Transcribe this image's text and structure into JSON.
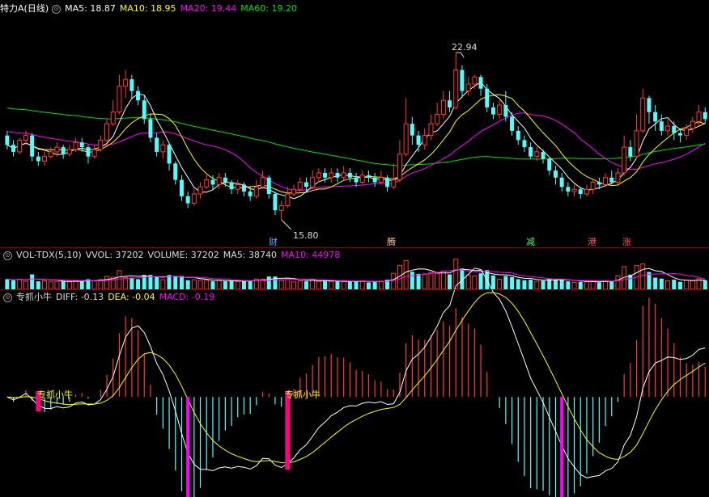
{
  "colors": {
    "bg": "#000000",
    "up": "#ff3b30",
    "down": "#54fcfc",
    "ma5": "#ffffff",
    "ma10": "#ffff00",
    "ma20": "#ff00ff",
    "ma60": "#00e000",
    "signal": "#ff0080",
    "macd_up": "#ff3b30",
    "macd_down": "#54fcfc",
    "macd_mark": "#ff00ff",
    "tag_text": "#ffff00"
  },
  "price_panel": {
    "title": "特力A",
    "period": "(日线)",
    "ma5": "MA5: 18.87",
    "ma10": "MA10: 18.95",
    "ma20": "MA20: 19.44",
    "ma60": "MA60: 19.20",
    "high_label": "22.94",
    "low_label": "15.80",
    "events": [
      {
        "label": "财",
        "color": "#6aa9ff"
      },
      {
        "label": "腾",
        "color": "#ffcc88"
      },
      {
        "label": "减",
        "color": "#55ff55"
      },
      {
        "label": "港",
        "color": "#ff5555"
      },
      {
        "label": "涨",
        "color": "#ff5555"
      }
    ]
  },
  "vol_panel": {
    "title": "VOL-TDX(5,10)",
    "vvol": "VVOL: 37202",
    "volume": "VOLUME: 37202",
    "ma5": "MA5: 38740",
    "ma10": "MA10: 44978"
  },
  "macd_panel": {
    "title": "专抓小牛",
    "diff": "DIFF: -0.13",
    "dea": "DEA: -0.04",
    "macd": "MACD: -0.19",
    "signal_tags": [
      "专抓小牛",
      "专抓小牛"
    ]
  },
  "chart_data": {
    "type": "candlestick",
    "note_scale": "price",
    "ylim": [
      15.0,
      24.5
    ],
    "candles": [
      [
        19.4,
        19.0,
        19.6,
        18.8
      ],
      [
        19.0,
        18.7,
        19.2,
        18.5
      ],
      [
        18.7,
        19.2,
        19.3,
        18.6
      ],
      [
        19.2,
        19.4,
        19.6,
        19.0
      ],
      [
        19.4,
        18.5,
        19.5,
        18.3
      ],
      [
        18.5,
        18.3,
        18.7,
        18.1
      ],
      [
        18.3,
        18.5,
        18.8,
        18.1
      ],
      [
        18.5,
        18.7,
        18.9,
        18.4
      ],
      [
        18.7,
        18.9,
        19.1,
        18.5
      ],
      [
        18.9,
        18.6,
        19.0,
        18.4
      ],
      [
        18.6,
        18.8,
        19.0,
        18.5
      ],
      [
        18.8,
        19.1,
        19.3,
        18.7
      ],
      [
        19.1,
        18.9,
        19.3,
        18.7
      ],
      [
        18.9,
        18.5,
        19.0,
        18.2
      ],
      [
        18.5,
        18.8,
        19.0,
        18.4
      ],
      [
        18.8,
        19.2,
        19.4,
        18.7
      ],
      [
        19.2,
        19.9,
        20.1,
        19.1
      ],
      [
        19.9,
        20.4,
        20.9,
        19.8
      ],
      [
        20.4,
        21.5,
        22.0,
        20.3
      ],
      [
        21.5,
        21.8,
        22.2,
        21.0
      ],
      [
        21.8,
        21.3,
        22.0,
        21.0
      ],
      [
        21.3,
        20.9,
        21.5,
        20.7
      ],
      [
        20.9,
        20.1,
        21.1,
        19.9
      ],
      [
        20.1,
        19.3,
        20.3,
        19.1
      ],
      [
        19.3,
        18.7,
        19.5,
        18.5
      ],
      [
        18.7,
        19.0,
        19.2,
        18.4
      ],
      [
        19.0,
        18.2,
        19.1,
        17.9
      ],
      [
        18.2,
        17.5,
        18.3,
        17.3
      ],
      [
        17.5,
        16.8,
        17.7,
        16.6
      ],
      [
        16.8,
        16.5,
        17.0,
        16.3
      ],
      [
        16.5,
        16.9,
        17.1,
        16.4
      ],
      [
        16.9,
        17.2,
        17.4,
        16.7
      ],
      [
        17.2,
        17.5,
        17.8,
        17.1
      ],
      [
        17.5,
        17.3,
        17.7,
        17.1
      ],
      [
        17.3,
        17.6,
        17.8,
        17.1
      ],
      [
        17.6,
        17.4,
        17.8,
        17.2
      ],
      [
        17.4,
        17.1,
        17.5,
        16.9
      ],
      [
        17.1,
        17.3,
        17.5,
        16.9
      ],
      [
        17.3,
        17.0,
        17.4,
        16.8
      ],
      [
        17.0,
        16.8,
        17.2,
        16.6
      ],
      [
        16.8,
        17.2,
        17.5,
        16.7
      ],
      [
        17.2,
        17.6,
        17.9,
        17.1
      ],
      [
        17.6,
        16.9,
        17.7,
        16.7
      ],
      [
        16.9,
        16.2,
        17.0,
        16.0
      ],
      [
        16.2,
        16.4,
        16.6,
        15.8
      ],
      [
        16.4,
        16.9,
        17.2,
        16.3
      ],
      [
        16.9,
        17.1,
        17.3,
        16.8
      ],
      [
        17.1,
        17.4,
        17.6,
        17.0
      ],
      [
        17.4,
        17.2,
        17.6,
        17.0
      ],
      [
        17.2,
        17.6,
        17.9,
        17.1
      ],
      [
        17.6,
        17.8,
        18.0,
        17.4
      ],
      [
        17.8,
        17.6,
        18.0,
        17.4
      ],
      [
        17.6,
        17.8,
        18.0,
        17.4
      ],
      [
        17.8,
        17.6,
        18.0,
        17.4
      ],
      [
        17.6,
        17.8,
        18.1,
        17.5
      ],
      [
        17.8,
        17.6,
        18.0,
        17.4
      ],
      [
        17.6,
        17.4,
        17.8,
        17.2
      ],
      [
        17.4,
        17.7,
        17.9,
        17.3
      ],
      [
        17.7,
        17.6,
        17.9,
        17.4
      ],
      [
        17.6,
        17.4,
        17.8,
        17.2
      ],
      [
        17.4,
        17.6,
        17.9,
        17.3
      ],
      [
        17.6,
        17.2,
        17.7,
        17.0
      ],
      [
        17.2,
        17.5,
        18.2,
        17.1
      ],
      [
        17.5,
        18.6,
        19.2,
        17.4
      ],
      [
        18.6,
        19.9,
        21.0,
        18.5
      ],
      [
        19.9,
        19.4,
        20.2,
        19.0
      ],
      [
        19.4,
        19.0,
        19.6,
        18.7
      ],
      [
        19.0,
        19.4,
        19.7,
        18.8
      ],
      [
        19.4,
        19.9,
        20.3,
        19.2
      ],
      [
        19.9,
        20.3,
        20.8,
        19.8
      ],
      [
        20.3,
        20.9,
        21.3,
        20.1
      ],
      [
        20.9,
        20.6,
        21.3,
        20.4
      ],
      [
        20.6,
        22.2,
        22.94,
        20.5
      ],
      [
        22.2,
        21.3,
        22.4,
        21.0
      ],
      [
        21.3,
        21.6,
        21.9,
        21.1
      ],
      [
        21.6,
        21.9,
        22.0,
        21.4
      ],
      [
        21.9,
        21.4,
        22.0,
        21.1
      ],
      [
        21.4,
        20.6,
        21.6,
        20.4
      ],
      [
        20.6,
        20.3,
        20.8,
        20.1
      ],
      [
        20.3,
        20.7,
        20.9,
        20.1
      ],
      [
        20.7,
        20.2,
        21.3,
        20.0
      ],
      [
        20.2,
        19.6,
        20.4,
        19.4
      ],
      [
        19.6,
        19.2,
        19.8,
        19.0
      ],
      [
        19.2,
        18.9,
        19.4,
        18.7
      ],
      [
        18.9,
        18.5,
        19.1,
        18.4
      ],
      [
        18.5,
        18.7,
        18.9,
        18.3
      ],
      [
        18.7,
        18.4,
        18.8,
        18.2
      ],
      [
        18.4,
        17.9,
        18.5,
        17.7
      ],
      [
        17.9,
        17.6,
        18.1,
        17.3
      ],
      [
        17.6,
        17.2,
        17.8,
        17.0
      ],
      [
        17.2,
        17.0,
        17.4,
        16.8
      ],
      [
        17.0,
        17.1,
        17.3,
        16.8
      ],
      [
        17.1,
        16.9,
        17.2,
        16.7
      ],
      [
        16.9,
        17.1,
        17.3,
        16.8
      ],
      [
        17.1,
        17.4,
        17.5,
        16.9
      ],
      [
        17.4,
        17.3,
        17.6,
        17.1
      ],
      [
        17.3,
        17.6,
        17.8,
        17.2
      ],
      [
        17.6,
        17.4,
        17.9,
        17.3
      ],
      [
        17.4,
        17.8,
        18.0,
        17.3
      ],
      [
        17.8,
        18.9,
        19.4,
        17.7
      ],
      [
        18.9,
        18.5,
        19.2,
        18.3
      ],
      [
        18.5,
        19.6,
        20.3,
        18.4
      ],
      [
        19.6,
        21.0,
        21.4,
        19.5
      ],
      [
        21.0,
        20.4,
        21.1,
        19.9
      ],
      [
        20.4,
        20.0,
        20.7,
        19.6
      ],
      [
        20.0,
        19.6,
        20.3,
        19.4
      ],
      [
        19.6,
        19.8,
        20.1,
        19.4
      ],
      [
        19.8,
        19.5,
        20.0,
        19.2
      ],
      [
        19.5,
        19.4,
        19.7,
        19.1
      ],
      [
        19.4,
        19.7,
        19.9,
        19.2
      ],
      [
        19.7,
        20.0,
        20.2,
        19.5
      ],
      [
        20.0,
        20.4,
        20.7,
        19.8
      ],
      [
        20.4,
        20.1,
        20.6,
        19.9
      ]
    ],
    "volume_ylim": [
      0,
      100000
    ],
    "macd_ylim": [
      -0.8,
      0.75
    ]
  }
}
